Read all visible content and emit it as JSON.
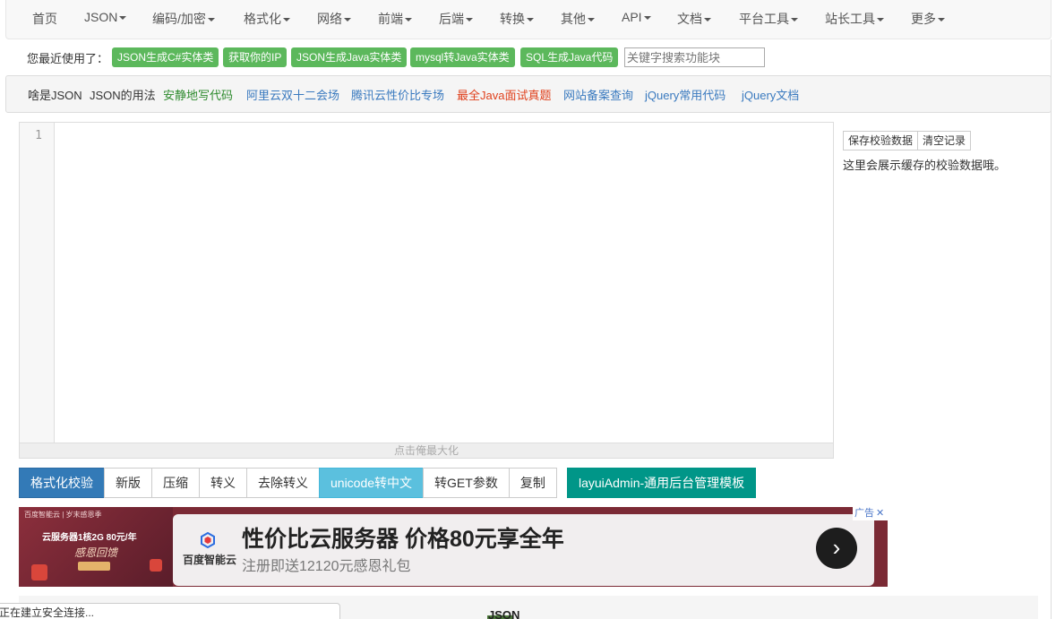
{
  "nav": {
    "items": [
      {
        "label": "首页",
        "dropdown": false
      },
      {
        "label": "JSON",
        "dropdown": true
      },
      {
        "label": "编码/加密",
        "dropdown": true
      },
      {
        "label": "格式化",
        "dropdown": true
      },
      {
        "label": "网络",
        "dropdown": true
      },
      {
        "label": "前端",
        "dropdown": true
      },
      {
        "label": "后端",
        "dropdown": true
      },
      {
        "label": "转换",
        "dropdown": true
      },
      {
        "label": "其他",
        "dropdown": true
      },
      {
        "label": "API",
        "dropdown": true
      },
      {
        "label": "文档",
        "dropdown": true
      },
      {
        "label": "平台工具",
        "dropdown": true
      },
      {
        "label": "站长工具",
        "dropdown": true
      },
      {
        "label": "更多",
        "dropdown": true
      }
    ]
  },
  "recent": {
    "label": "您最近使用了：",
    "tags": [
      "JSON生成C#实体类",
      "获取你的IP",
      "JSON生成Java实体类",
      "mysql转Java实体类",
      "SQL生成Java代码"
    ],
    "search_placeholder": "关键字搜索功能块"
  },
  "links": [
    {
      "label": "啥是JSON",
      "color": "#333333"
    },
    {
      "label": "JSON的用法",
      "color": "#333333"
    },
    {
      "label": "安静地写代码",
      "color": "#2e8b2e"
    },
    {
      "label": "阿里云双十二会场",
      "color": "#3a7abf"
    },
    {
      "label": "腾讯云性价比专场",
      "color": "#3a7abf"
    },
    {
      "label": "最全Java面试真题",
      "color": "#e0411d"
    },
    {
      "label": "网站备案查询",
      "color": "#3a7abf"
    },
    {
      "label": "jQuery常用代码",
      "color": "#3a7abf"
    },
    {
      "label": "jQuery文档",
      "color": "#3a7abf"
    }
  ],
  "editor": {
    "line_number": "1",
    "maximize_label": "点击俺最大化"
  },
  "side": {
    "save_label": "保存校验数据",
    "clear_label": "清空记录",
    "empty_text": "这里会展示缓存的校验数据哦。"
  },
  "actions": {
    "format": "格式化校验",
    "new_version": "新版",
    "compress": "压缩",
    "escape": "转义",
    "unescape": "去除转义",
    "unicode": "unicode转中文",
    "get_params": "转GET参数",
    "copy": "复制",
    "layui": "layuiAdmin-通用后台管理模板"
  },
  "ad": {
    "brand_small": "百度智能云 | 岁末感恩季",
    "promo_line1": "云服务器1核2G 80元/年",
    "promo_line2": "感恩回馈",
    "logo_text": "百度智能云",
    "title": "性价比云服务器 价格80元享全年",
    "subtitle": "注册即送12120元感恩礼包",
    "ad_label": "广告",
    "close": "✕",
    "arrow": "›"
  },
  "status": {
    "text": "正在建立安全连接..."
  },
  "footer_logo": "JSON"
}
